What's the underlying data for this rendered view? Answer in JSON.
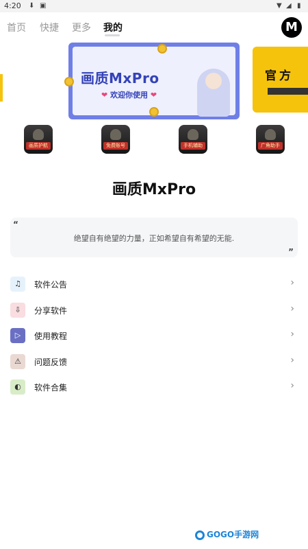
{
  "status_bar": {
    "time": "4:20",
    "icons": [
      "download-icon",
      "notification-icon",
      "wifi-icon",
      "signal-icon",
      "battery-icon"
    ]
  },
  "tabs": [
    {
      "label": "首页",
      "active": false
    },
    {
      "label": "快捷",
      "active": false
    },
    {
      "label": "更多",
      "active": false
    },
    {
      "label": "我的",
      "active": true
    }
  ],
  "header": {
    "logo_letter": "M"
  },
  "banner": {
    "title": "画质MxPro",
    "subtitle": "欢迎你使用",
    "side_text": "官方"
  },
  "game_icons": [
    {
      "label": "画质护航"
    },
    {
      "label": "免费账号"
    },
    {
      "label": "手机辅助"
    },
    {
      "label": "广角助手"
    }
  ],
  "app_name": "画质MxPro",
  "quote": {
    "open_mark": "“",
    "close_mark": "”",
    "text": "绝望自有绝望的力量，正如希望自有希望的无能."
  },
  "menu": [
    {
      "label": "软件公告",
      "icon": "bell-icon",
      "color": "#e6f2fb"
    },
    {
      "label": "分享软件",
      "icon": "share-icon",
      "color": "#f9dde0"
    },
    {
      "label": "使用教程",
      "icon": "play-icon",
      "color": "#6a6fc4"
    },
    {
      "label": "问题反馈",
      "icon": "warning-icon",
      "color": "#ead9d3"
    },
    {
      "label": "软件合集",
      "icon": "planet-icon",
      "color": "#d9ecc8"
    }
  ],
  "watermark": {
    "text": "GOGO手游网"
  }
}
